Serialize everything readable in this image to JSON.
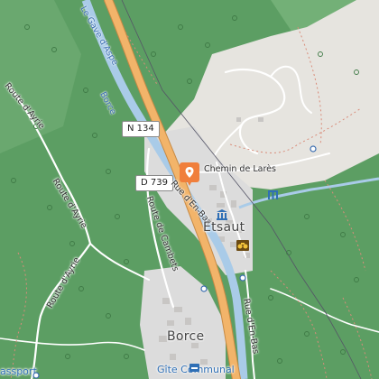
{
  "map": {
    "towns": {
      "etsaut": "Etsaut",
      "borce": "Borce"
    },
    "shields": {
      "n134": "N 134",
      "d739": "D 739"
    },
    "roads": {
      "chemin_de_lares": "Chemin de Larès",
      "rue_en_bas": "Rue d'En-Bas",
      "route_de_cambets": "Route de Cambets",
      "route_daydius": "Route d'Aydius",
      "route_dayrie_1": "Route d'Ayrie",
      "route_dayrie_2": "Route d'Ayrie",
      "route_dayrie_3": "Route d'Ayrie",
      "rue_en_bas_south": "Rue d'En-Bas"
    },
    "river": "Le Gave d'Aspe",
    "partial": {
      "borce_top": "Borce",
      "gite": "Gîte Communal",
      "passport_fragment": "assport"
    },
    "colors": {
      "forest": "#5b9e62",
      "clearing": "#e6e4df",
      "river": "#a9cbe8",
      "main_road": "#f2b46a",
      "marker": "#f07f3c"
    }
  }
}
